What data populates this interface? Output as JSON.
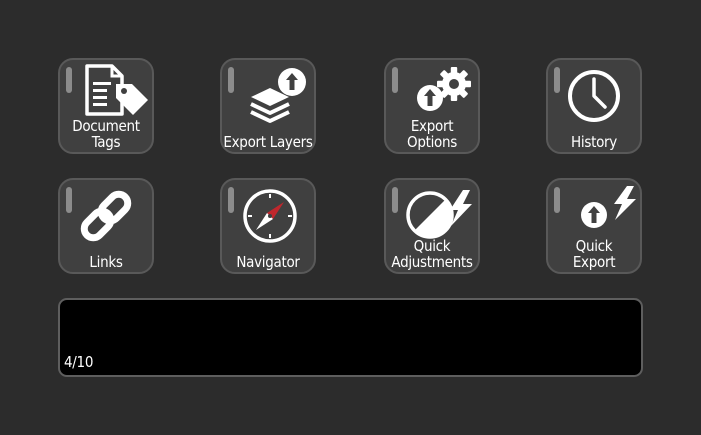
{
  "buttons": [
    {
      "id": "document-tags",
      "lines": [
        "Document",
        "Tags"
      ],
      "icon": "document-tag-icon"
    },
    {
      "id": "export-layers",
      "lines": [
        "Export Layers"
      ],
      "icon": "layers-upload-icon"
    },
    {
      "id": "export-options",
      "lines": [
        "Export",
        "Options"
      ],
      "icon": "export-gear-icon"
    },
    {
      "id": "history",
      "lines": [
        "History"
      ],
      "icon": "clock-icon"
    },
    {
      "id": "links",
      "lines": [
        "Links"
      ],
      "icon": "chain-link-icon"
    },
    {
      "id": "navigator",
      "lines": [
        "Navigator"
      ],
      "icon": "compass-icon"
    },
    {
      "id": "quick-adjustments",
      "lines": [
        "Quick",
        "Adjustments"
      ],
      "icon": "adjust-lightning-icon"
    },
    {
      "id": "quick-export",
      "lines": [
        "Quick",
        "Export"
      ],
      "icon": "export-lightning-icon"
    }
  ],
  "display": {
    "page_indicator": "4/10"
  },
  "colors": {
    "background": "#2c2c2c",
    "button_face": "#404040",
    "button_border": "#595959",
    "led": "#8c8c8c",
    "text": "#ffffff",
    "display": "#000000",
    "compass_needle": "#c0272d"
  }
}
